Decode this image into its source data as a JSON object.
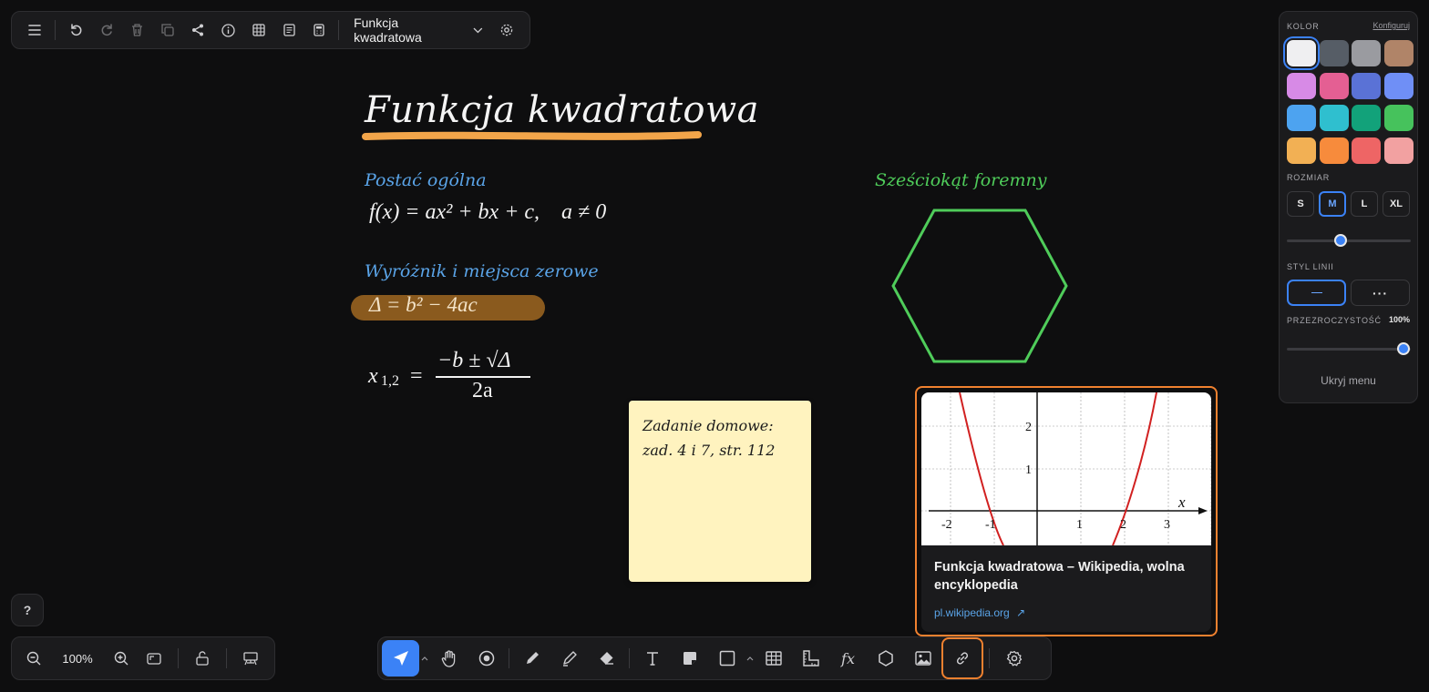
{
  "topbar": {
    "board_title": "Funkcja kwadratowa"
  },
  "canvas": {
    "main_title": "Funkcja kwadratowa",
    "heading_general": "Postać ogólna",
    "formula_general": "f(x) = ax² + bx + c,    a ≠ 0",
    "heading_delta": "Wyróżnik i miejsca zerowe",
    "formula_delta": "Δ = b² − 4ac",
    "formula_roots_left": "x",
    "formula_roots_sub": "1,2",
    "formula_roots_num": "−b ± √Δ",
    "formula_roots_den": "2a",
    "heading_hexagon": "Sześciokąt foremny",
    "sticky_note_line1": "Zadanie domowe:",
    "sticky_note_line2": "zad. 4 i 7, str. 112",
    "link_card": {
      "title": "Funkcja kwadratowa – Wikipedia, wolna encyklopedia",
      "domain": "pl.wikipedia.org",
      "arrow": "↗",
      "preview_axis_x_labels": [
        "-2",
        "-1",
        "1",
        "2",
        "3"
      ],
      "preview_axis_y_labels": [
        "2",
        "1"
      ],
      "preview_axis_x_name": "x"
    }
  },
  "style_panel": {
    "color_label": "KOLOR",
    "configure_link": "Konfiguruj",
    "colors": [
      "#efeff1",
      "#565d66",
      "#9a9ba0",
      "#b08468",
      "#d78ae6",
      "#e45f93",
      "#5a72d6",
      "#6f8ff6",
      "#4da3f0",
      "#2fbfcf",
      "#12a27a",
      "#46c25c",
      "#f2b054",
      "#f78b3c",
      "#ee6565",
      "#f2a1a1"
    ],
    "selected_color": "#efeff1",
    "size_label": "ROZMIAR",
    "sizes": [
      "S",
      "M",
      "L",
      "XL"
    ],
    "selected_size": "M",
    "line_style_label": "STYL LINII",
    "opacity_label": "PRZEZROCZYSTOŚĆ",
    "opacity_value": "100%",
    "hide_menu": "Ukryj menu"
  },
  "zoombar": {
    "zoom_value": "100%"
  },
  "help_label": "?",
  "colors": {
    "accent": "#3b82f6",
    "orange_active": "#f0812f",
    "hexagon": "#4fcc5a",
    "heading_blue": "#5aa4e8",
    "sticky": "#fff3bf"
  }
}
